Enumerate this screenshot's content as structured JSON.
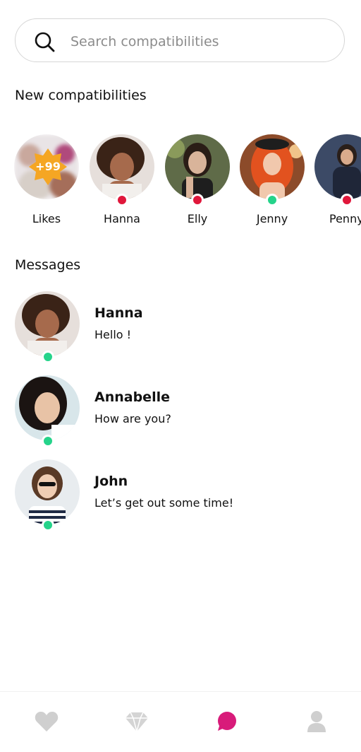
{
  "search": {
    "placeholder": "Search compatibilities",
    "value": ""
  },
  "sections": {
    "new_title": "New compatibilities",
    "messages_title": "Messages"
  },
  "compatibilities": [
    {
      "name": "Likes",
      "badge": "+99",
      "badge_color": "#f5a623"
    },
    {
      "name": "Hanna",
      "status": "offline",
      "status_color": "#e0173b"
    },
    {
      "name": "Elly",
      "status": "offline",
      "status_color": "#e0173b"
    },
    {
      "name": "Jenny",
      "status": "online",
      "status_color": "#25d38a"
    },
    {
      "name": "Penny",
      "status": "offline",
      "status_color": "#e0173b"
    }
  ],
  "messages": [
    {
      "name": "Hanna",
      "text": "Hello !",
      "status_color": "#25d38a"
    },
    {
      "name": "Annabelle",
      "text": "How are you?",
      "status_color": "#25d38a"
    },
    {
      "name": "John",
      "text": "Let’s get out some time!",
      "status_color": "#25d38a"
    }
  ],
  "nav": [
    {
      "icon": "heart-icon",
      "active": false
    },
    {
      "icon": "diamond-icon",
      "active": false
    },
    {
      "icon": "chat-bubble-icon",
      "active": true,
      "color": "#d81b7a"
    },
    {
      "icon": "profile-icon",
      "active": false
    }
  ]
}
